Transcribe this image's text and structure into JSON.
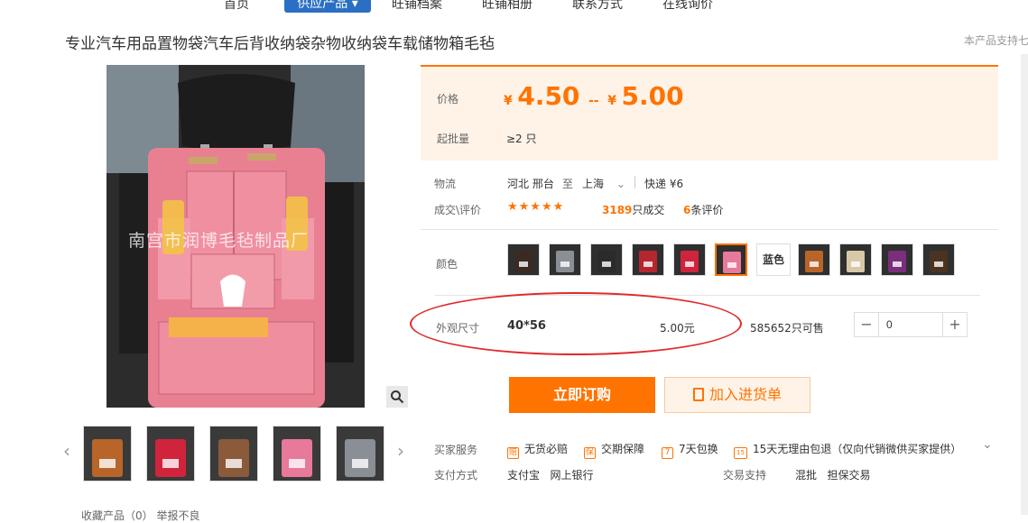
{
  "nav": {
    "items": [
      {
        "label": "首页"
      },
      {
        "label": "供应产品 ▾"
      },
      {
        "label": "旺铺档案"
      },
      {
        "label": "旺铺相册"
      },
      {
        "label": "联系方式"
      },
      {
        "label": "在线询价"
      }
    ]
  },
  "product": {
    "title": "专业汽车用品置物袋汽车后背收纳袋杂物收纳袋车载储物箱毛毡",
    "support_note": "本产品支持七",
    "watermark": "南宫市润博毛毡制品厂"
  },
  "price": {
    "label": "价格",
    "currency": "¥",
    "low": "4.50",
    "separator": "--",
    "high": "5.00",
    "moq_label": "起批量",
    "moq_value": "≥2 只"
  },
  "logistics": {
    "label": "物流",
    "from": "河北 邢台",
    "to_word": "至",
    "to": "上海",
    "express": "快递 ¥6"
  },
  "deals": {
    "label": "成交\\评价",
    "stars": "★★★★★",
    "count": "3189",
    "count_suffix": "只成交",
    "reviews": "6",
    "reviews_suffix": "条评价"
  },
  "color": {
    "label": "颜色",
    "text_option": "蓝色",
    "swatch_colors": [
      "#3a2a22",
      "#8a8f96",
      "#2b2b2b",
      "#b5272f",
      "#d0243c",
      "#e7799b",
      "#b8652a",
      "#d8c8a8",
      "#7a2e7c",
      "#4a3320"
    ],
    "selected_index": 5,
    "accent": "#ff7300"
  },
  "size": {
    "label": "外观尺寸",
    "value": "40*56",
    "price": "5.00元",
    "stock": "585652只可售",
    "minus": "−",
    "plus": "+",
    "quantity": "0"
  },
  "buttons": {
    "order": "立即订购",
    "cart": "加入进货单"
  },
  "services": {
    "label": "买家服务",
    "items": [
      {
        "icon": "赔",
        "label": "无货必赔"
      },
      {
        "icon": "保",
        "label": "交期保障"
      },
      {
        "icon": "7",
        "label": "7天包换"
      },
      {
        "icon": "15",
        "label": "15天无理由包退（仅向代销微供买家提供）"
      }
    ]
  },
  "payment": {
    "label": "支付方式",
    "methods": "支付宝   网上银行",
    "trade_label": "交易支持",
    "trade": "混批   担保交易"
  },
  "thumbs": {
    "colors": [
      "#b8652a",
      "#d0243c",
      "#8a5a3a",
      "#e7799b",
      "#8a8f96"
    ]
  },
  "favorites": {
    "label": "收藏产品（0）    举报不良"
  }
}
